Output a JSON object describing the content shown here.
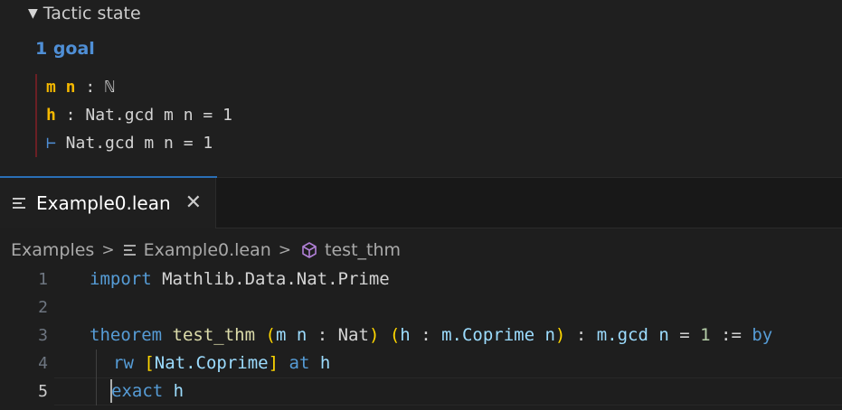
{
  "infoview": {
    "header": "Tactic state",
    "goal_count": "1 goal",
    "hyps": [
      {
        "names": "m n",
        "sep": " : ",
        "type": "ℕ"
      },
      {
        "names": "h",
        "sep": " : ",
        "type": "Nat.gcd m n = 1"
      }
    ],
    "goal": {
      "turnstile": "⊢",
      "type": " Nat.gcd m n = 1"
    }
  },
  "tab": {
    "label": "Example0.lean",
    "close": "✕"
  },
  "breadcrumb": {
    "folder": "Examples",
    "file": "Example0.lean",
    "symbol": "test_thm",
    "sep": ">"
  },
  "editor": {
    "line_numbers": [
      "1",
      "2",
      "3",
      "4",
      "5"
    ],
    "line1": {
      "kw": "import",
      "rest": " Mathlib.Data.Nat.Prime"
    },
    "line3": {
      "kw_theorem": "theorem",
      "name": "test_thm",
      "open1": "(",
      "binder1": "m n",
      "colon1": " : ",
      "type1": "Nat",
      "close1": ")",
      "open2": "(",
      "binder2": "h",
      "colon2": " : ",
      "type2": "m.Coprime n",
      "close2": ")",
      "colon3": " : ",
      "concl_a": "m.gcd n",
      "eq": " = ",
      "one": "1",
      "assign": " := ",
      "by": "by"
    },
    "line4": {
      "kw": "rw",
      "open": "[",
      "lemma": "Nat.Coprime",
      "close": "]",
      "at": "at",
      "hyp": "h"
    },
    "line5": {
      "kw": "exact",
      "arg": "h"
    }
  },
  "colors": {
    "goal_accent": "#4f8fd6",
    "hyp_name": "#f5b800",
    "keyword": "#569cd6",
    "function": "#dcdcaa",
    "variable": "#9cdcfe",
    "number": "#b5cea8"
  },
  "icons": {
    "header_toggle": "triangle-down-icon",
    "tab_file": "file-lines-icon",
    "breadcrumb_file": "file-lines-icon",
    "breadcrumb_symbol": "cube-symbol-icon"
  }
}
